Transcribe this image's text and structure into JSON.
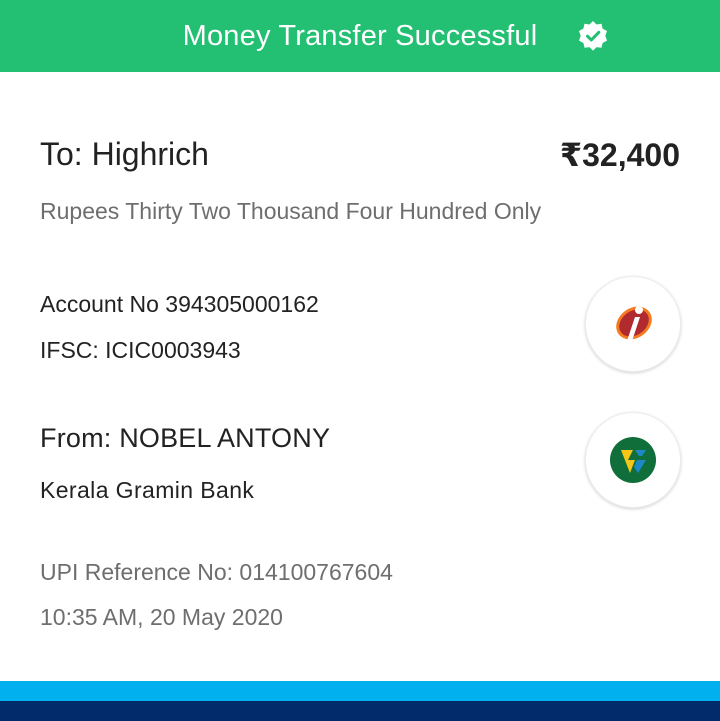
{
  "header": {
    "title": "Money Transfer Successful",
    "icon": "verified-check-icon",
    "background_color": "#23c073"
  },
  "recipient": {
    "to_label": "To: Highrich",
    "amount": "₹32,400",
    "amount_in_words": "Rupees Thirty Two Thousand Four Hundred Only",
    "account_no": "Account No 394305000162",
    "ifsc": "IFSC: ICIC0003943",
    "bank_logo": "icici-bank-logo"
  },
  "sender": {
    "from_label": "From: NOBEL ANTONY",
    "bank_name": "Kerala Gramin Bank",
    "bank_logo": "kerala-gramin-bank-logo"
  },
  "transaction": {
    "upi_reference": "UPI Reference No: 014100767604",
    "timestamp": "10:35 AM, 20 May 2020"
  },
  "footer": {
    "light_bar_color": "#00b0ef",
    "dark_bar_color": "#012b6b"
  }
}
